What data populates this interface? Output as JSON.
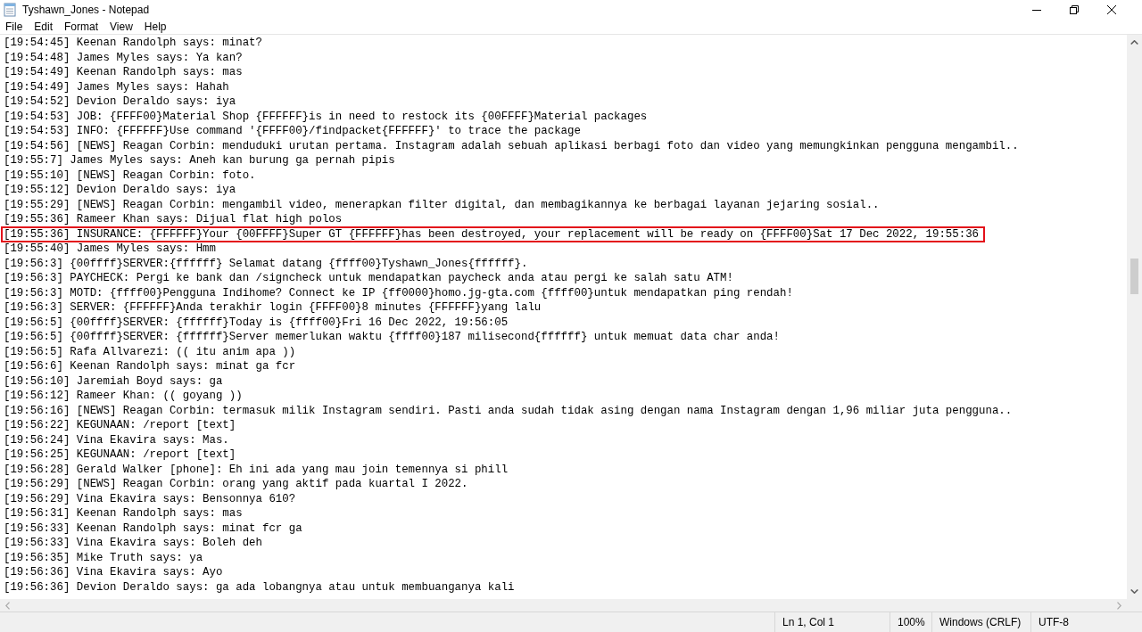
{
  "window": {
    "title": "Tyshawn_Jones - Notepad"
  },
  "menu": [
    "File",
    "Edit",
    "Format",
    "View",
    "Help"
  ],
  "lines": [
    {
      "text": "[19:54:45] Keenan Randolph says: minat?",
      "highlighted": false
    },
    {
      "text": "[19:54:48] James Myles says: Ya kan?",
      "highlighted": false
    },
    {
      "text": "[19:54:49] Keenan Randolph says: mas",
      "highlighted": false
    },
    {
      "text": "[19:54:49] James Myles says: Hahah",
      "highlighted": false
    },
    {
      "text": "[19:54:52] Devion Deraldo says: iya",
      "highlighted": false
    },
    {
      "text": "[19:54:53] JOB: {FFFF00}Material Shop {FFFFFF}is in need to restock its {00FFFF}Material packages",
      "highlighted": false
    },
    {
      "text": "[19:54:53] INFO: {FFFFFF}Use command '{FFFF00}/findpacket{FFFFFF}' to trace the package",
      "highlighted": false
    },
    {
      "text": "[19:54:56] [NEWS] Reagan Corbin: menduduki urutan pertama. Instagram adalah sebuah aplikasi berbagi foto dan video yang memungkinkan pengguna mengambil..",
      "highlighted": false
    },
    {
      "text": "[19:55:7] James Myles says: Aneh kan burung ga pernah pipis",
      "highlighted": false
    },
    {
      "text": "[19:55:10] [NEWS] Reagan Corbin: foto.",
      "highlighted": false
    },
    {
      "text": "[19:55:12] Devion Deraldo says: iya",
      "highlighted": false
    },
    {
      "text": "[19:55:29] [NEWS] Reagan Corbin: mengambil video, menerapkan filter digital, dan membagikannya ke berbagai layanan jejaring sosial..",
      "highlighted": false
    },
    {
      "text": "[19:55:36] Rameer Khan says: Dijual flat high polos",
      "highlighted": false
    },
    {
      "text": "[19:55:36] INSURANCE: {FFFFFF}Your {00FFFF}Super GT {FFFFFF}has been destroyed, your replacement will be ready on {FFFF00}Sat 17 Dec 2022, 19:55:36",
      "highlighted": true
    },
    {
      "text": "[19:55:40] James Myles says: Hmm",
      "highlighted": false
    },
    {
      "text": "[19:56:3] {00ffff}SERVER:{ffffff} Selamat datang {ffff00}Tyshawn_Jones{ffffff}.",
      "highlighted": false
    },
    {
      "text": "[19:56:3] PAYCHECK: Pergi ke bank dan /signcheck untuk mendapatkan paycheck anda atau pergi ke salah satu ATM!",
      "highlighted": false
    },
    {
      "text": "[19:56:3] MOTD: {ffff00}Pengguna Indihome? Connect ke IP {ff0000}homo.jg-gta.com {ffff00}untuk mendapatkan ping rendah!",
      "highlighted": false
    },
    {
      "text": "[19:56:3] SERVER: {FFFFFF}Anda terakhir login {FFFF00}8 minutes {FFFFFF}yang lalu",
      "highlighted": false
    },
    {
      "text": "[19:56:5] {00ffff}SERVER: {ffffff}Today is {ffff00}Fri 16 Dec 2022, 19:56:05",
      "highlighted": false
    },
    {
      "text": "[19:56:5] {00ffff}SERVER: {ffffff}Server memerlukan waktu {ffff00}187 milisecond{ffffff} untuk memuat data char anda!",
      "highlighted": false
    },
    {
      "text": "[19:56:5] Rafa Allvarezi: (( itu anim apa ))",
      "highlighted": false
    },
    {
      "text": "[19:56:6] Keenan Randolph says: minat ga fcr",
      "highlighted": false
    },
    {
      "text": "[19:56:10] Jaremiah Boyd says: ga",
      "highlighted": false
    },
    {
      "text": "[19:56:12] Rameer Khan: (( goyang ))",
      "highlighted": false
    },
    {
      "text": "[19:56:16] [NEWS] Reagan Corbin: termasuk milik Instagram sendiri. Pasti anda sudah tidak asing dengan nama Instagram dengan 1,96 miliar juta pengguna..",
      "highlighted": false
    },
    {
      "text": "[19:56:22] KEGUNAAN: /report [text]",
      "highlighted": false
    },
    {
      "text": "[19:56:24] Vina Ekavira says: Mas.",
      "highlighted": false
    },
    {
      "text": "[19:56:25] KEGUNAAN: /report [text]",
      "highlighted": false
    },
    {
      "text": "[19:56:28] Gerald Walker [phone]: Eh ini ada yang mau join temennya si phill",
      "highlighted": false
    },
    {
      "text": "[19:56:29] [NEWS] Reagan Corbin: orang yang aktif pada kuartal I 2022.",
      "highlighted": false
    },
    {
      "text": "[19:56:29] Vina Ekavira says: Bensonnya 610?",
      "highlighted": false
    },
    {
      "text": "[19:56:31] Keenan Randolph says: mas",
      "highlighted": false
    },
    {
      "text": "[19:56:33] Keenan Randolph says: minat fcr ga",
      "highlighted": false
    },
    {
      "text": "[19:56:33] Vina Ekavira says: Boleh deh",
      "highlighted": false
    },
    {
      "text": "[19:56:35] Mike Truth says: ya",
      "highlighted": false
    },
    {
      "text": "[19:56:36] Vina Ekavira says: Ayo",
      "highlighted": false
    },
    {
      "text": "[19:56:36] Devion Deraldo says: ga ada lobangnya atau untuk membuanganya kali",
      "highlighted": false
    }
  ],
  "status_bar": {
    "position": "Ln 1, Col 1",
    "zoom": "100%",
    "line_ending": "Windows (CRLF)",
    "encoding": "UTF-8"
  }
}
